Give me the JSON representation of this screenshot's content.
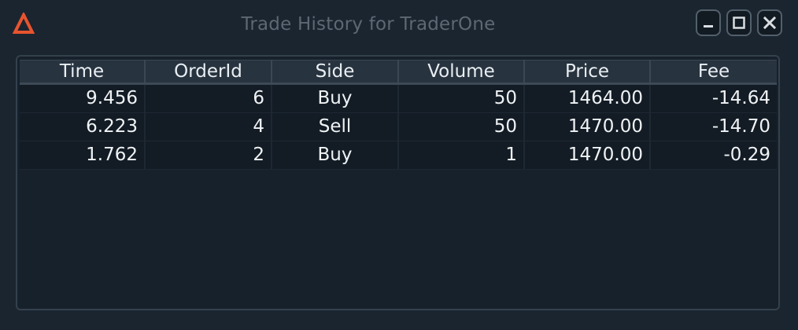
{
  "window": {
    "title": "Trade History for TraderOne",
    "logo_icon": "delta-triangle-icon",
    "accent_color": "#e8542f",
    "controls": {
      "minimize_icon": "minimize-icon",
      "maximize_icon": "maximize-icon",
      "close_icon": "close-icon"
    }
  },
  "table": {
    "columns": [
      "Time",
      "OrderId",
      "Side",
      "Volume",
      "Price",
      "Fee"
    ],
    "rows": [
      {
        "time": "9.456",
        "order_id": "6",
        "side": "Buy",
        "volume": "50",
        "price": "1464.00",
        "fee": "-14.64"
      },
      {
        "time": "6.223",
        "order_id": "4",
        "side": "Sell",
        "volume": "50",
        "price": "1470.00",
        "fee": "-14.70"
      },
      {
        "time": "1.762",
        "order_id": "2",
        "side": "Buy",
        "volume": "1",
        "price": "1470.00",
        "fee": "-0.29"
      }
    ]
  }
}
